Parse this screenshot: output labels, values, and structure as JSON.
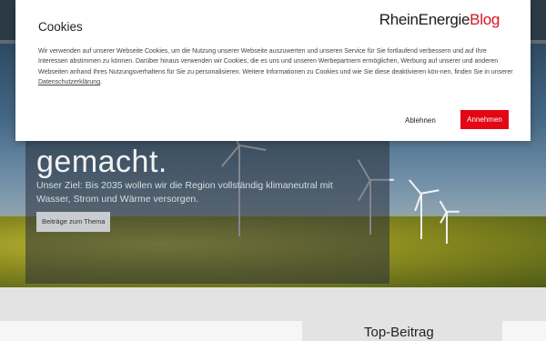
{
  "cookie_banner": {
    "title": "Cookies",
    "brand_name": "RheinEnergie",
    "brand_suffix": "Blog",
    "text_before_link": "Wir verwenden auf unserer Webseite Cookies, um die Nutzung unserer Webseite auszuwerten und unseren Service für Sie fortlaufend verbessern und auf Ihre Interessen abstimmen zu können. Darüber hinaus verwenden wir Cookies, die es uns und unseren Werbepartnern ermöglichen, Werbung auf unserer und anderen Webseiten anhand Ihres Nutzungsverhaltens für Sie zu personalisieren. Weitere Informationen zu Cookies und wie Sie diese deaktivieren kön-nen, finden Sie in unserer",
    "privacy_link": "Datenschutzerklärung",
    "text_after_link": ".",
    "decline_label": "Ablehnen",
    "accept_label": "Annehmen"
  },
  "hero": {
    "title": "gemacht.",
    "subtitle": "Unser Ziel: Bis 2035 wollen wir die Region vollständig klimaneutral mit Wasser, Strom und Wärme versorgen.",
    "button_label": "Beiträge zum Thema"
  },
  "sidebar": {
    "heading": "Top-Beitrag"
  },
  "colors": {
    "accent": "#e30613",
    "header": "#2b3a45"
  }
}
